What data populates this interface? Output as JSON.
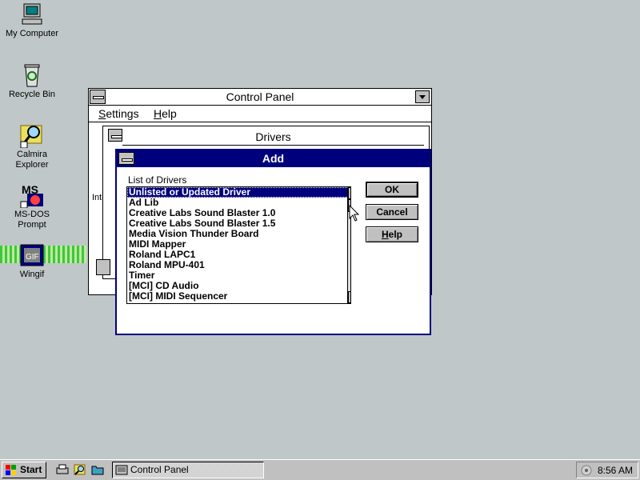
{
  "desktop": {
    "icons": [
      {
        "label": "My Computer"
      },
      {
        "label": "Recycle Bin"
      },
      {
        "label": "Calmira\nExplorer"
      },
      {
        "label": "MS-DOS\nPrompt"
      },
      {
        "label": "Wingif"
      }
    ]
  },
  "control_panel": {
    "title": "Control Panel",
    "menu": [
      {
        "label": "Settings",
        "accel": "S",
        "rest": "ettings"
      },
      {
        "label": "Help",
        "accel": "H",
        "rest": "elp"
      }
    ],
    "fragments": [
      "I",
      "Inte"
    ]
  },
  "drivers": {
    "title": "Drivers"
  },
  "add_dialog": {
    "title": "Add",
    "list_label": "List of Drivers",
    "items": [
      "Unlisted or Updated Driver",
      "Ad Lib",
      "Creative Labs Sound Blaster 1.0",
      "Creative Labs Sound Blaster 1.5",
      "Media Vision Thunder Board",
      "MIDI Mapper",
      "Roland LAPC1",
      "Roland MPU-401",
      "Timer",
      "[MCI] CD Audio",
      "[MCI] MIDI Sequencer"
    ],
    "selected_index": 0,
    "buttons": {
      "ok": "OK",
      "cancel": "Cancel",
      "help_accel": "H",
      "help_rest": "elp"
    }
  },
  "taskbar": {
    "start_label": "Start",
    "task_label": "Control Panel",
    "clock": "8:56 AM"
  },
  "colors": {
    "desktop": "#c0c7c8",
    "title_active": "#00007c"
  }
}
